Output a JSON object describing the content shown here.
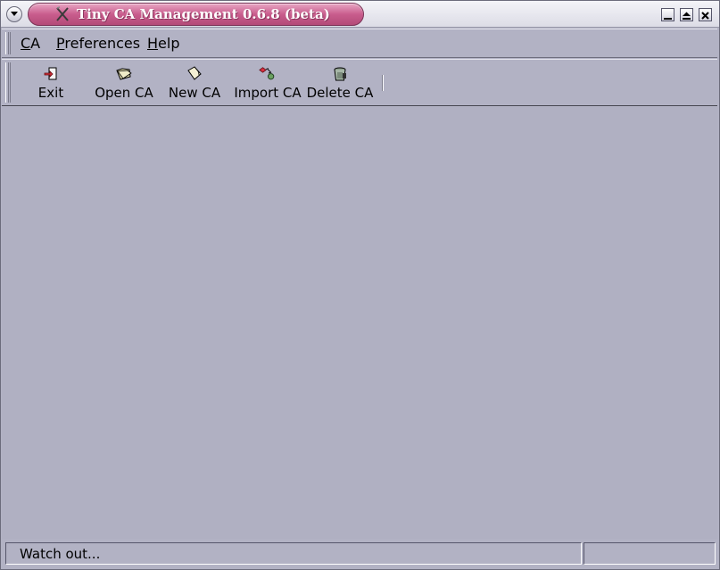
{
  "window": {
    "title": "Tiny CA Management 0.6.8 (beta)",
    "title_accent": "#c95d8d"
  },
  "menubar": {
    "items": [
      {
        "label": "CA",
        "underline": "C",
        "rest": "A"
      },
      {
        "label": "Preferences",
        "underline": "P",
        "rest": "references"
      },
      {
        "label": "Help",
        "underline": "H",
        "rest": "elp"
      }
    ]
  },
  "toolbar": {
    "buttons": [
      {
        "label": "Exit",
        "icon": "exit-icon"
      },
      {
        "label": "Open CA",
        "icon": "open-ca-icon"
      },
      {
        "label": "New CA",
        "icon": "new-ca-icon"
      },
      {
        "label": "Import CA",
        "icon": "import-ca-icon"
      },
      {
        "label": "Delete CA",
        "icon": "delete-ca-icon"
      }
    ]
  },
  "statusbar": {
    "message": "Watch out...",
    "secondary": ""
  }
}
